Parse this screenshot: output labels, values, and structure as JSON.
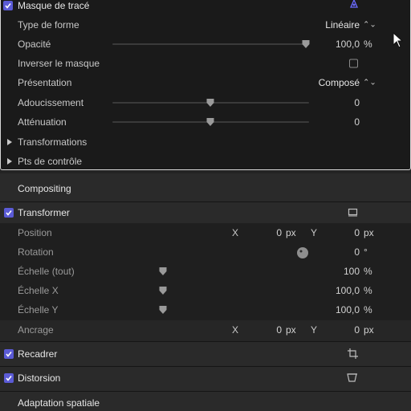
{
  "mask": {
    "title": "Masque de tracé",
    "enabled": true,
    "shape_type_label": "Type de forme",
    "shape_type_value": "Linéaire",
    "opacity_label": "Opacité",
    "opacity_value": "100,0",
    "opacity_unit": "%",
    "opacity_level": 1.0,
    "invert_label": "Inverser le masque",
    "invert_checked": false,
    "presentation_label": "Présentation",
    "presentation_value": "Composé",
    "feather_label": "Adoucissement",
    "feather_value": "0",
    "falloff_label": "Atténuation",
    "falloff_value": "0",
    "transforms_label": "Transformations",
    "control_points_label": "Pts de contrôle"
  },
  "compositing": {
    "title": "Compositing"
  },
  "transform": {
    "title": "Transformer",
    "enabled": true,
    "position_label": "Position",
    "x_label": "X",
    "position_x": "0",
    "y_label": "Y",
    "position_y": "0",
    "px_unit": "px",
    "rotation_label": "Rotation",
    "rotation_value": "0",
    "rotation_unit": "°",
    "scale_all_label": "Échelle (tout)",
    "scale_all_value": "100",
    "scale_x_label": "Échelle X",
    "scale_x_value": "100,0",
    "scale_y_label": "Échelle Y",
    "scale_y_value": "100,0",
    "percent_unit": "%",
    "anchor_label": "Ancrage",
    "anchor_x": "0",
    "anchor_y": "0"
  },
  "crop": {
    "title": "Recadrer",
    "enabled": true
  },
  "distort": {
    "title": "Distorsion",
    "enabled": true
  },
  "spatial": {
    "title": "Adaptation spatiale"
  },
  "colors": {
    "accent": "#5b5bd6",
    "panel_border": "#d8d8d8"
  },
  "icons": [
    "checkmark-icon",
    "popup-arrows-icon",
    "slider-thumb-icon",
    "disclosure-triangle-icon",
    "transform-onscreen-icon",
    "crop-onscreen-icon",
    "distort-onscreen-icon",
    "rotation-dial-icon",
    "mask-tool-icon",
    "mouse-cursor-icon"
  ]
}
